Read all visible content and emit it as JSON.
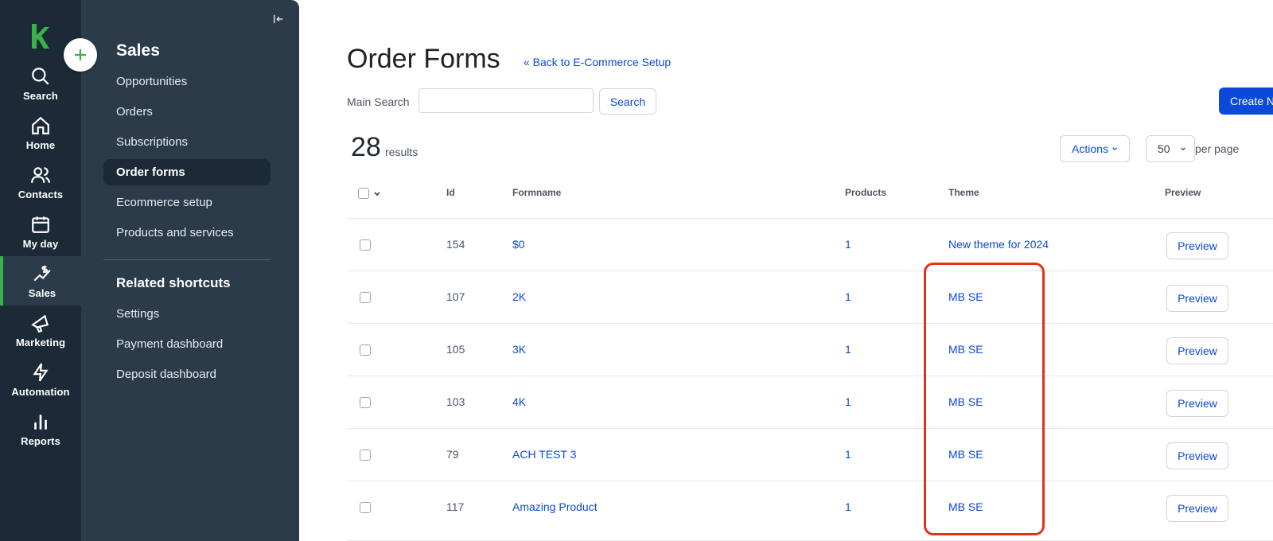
{
  "rail": {
    "items": [
      {
        "label": "Search",
        "icon": "search-icon"
      },
      {
        "label": "Home",
        "icon": "home-icon"
      },
      {
        "label": "Contacts",
        "icon": "contacts-icon"
      },
      {
        "label": "My day",
        "icon": "calendar-icon"
      },
      {
        "label": "Sales",
        "icon": "sales-icon",
        "active": true
      },
      {
        "label": "Marketing",
        "icon": "megaphone-icon"
      },
      {
        "label": "Automation",
        "icon": "lightning-icon"
      },
      {
        "label": "Reports",
        "icon": "bar-chart-icon"
      }
    ],
    "brand_color": "#37b34a"
  },
  "sidebar": {
    "title": "Sales",
    "items": [
      {
        "label": "Opportunities"
      },
      {
        "label": "Orders"
      },
      {
        "label": "Subscriptions"
      },
      {
        "label": "Order forms",
        "active": true
      },
      {
        "label": "Ecommerce setup"
      },
      {
        "label": "Products and services"
      }
    ],
    "shortcuts_title": "Related shortcuts",
    "shortcuts": [
      {
        "label": "Settings"
      },
      {
        "label": "Payment dashboard"
      },
      {
        "label": "Deposit dashboard"
      }
    ]
  },
  "header": {
    "title": "Order Forms",
    "back_link": "« Back to E-Commerce Setup",
    "search_label": "Main Search",
    "search_value": "",
    "search_button": "Search",
    "create_button": "Create N"
  },
  "summary": {
    "count": "28",
    "results_label": "results",
    "actions_label": "Actions",
    "per_page_value": "50",
    "per_page_label": "per page"
  },
  "table": {
    "columns": [
      "Id",
      "Formname",
      "Products",
      "Theme",
      "Preview"
    ],
    "rows": [
      {
        "id": "154",
        "formname": "$0",
        "products": "1",
        "theme": "New theme for 2024",
        "preview": "Preview"
      },
      {
        "id": "107",
        "formname": "2K",
        "products": "1",
        "theme": "MB SE",
        "preview": "Preview"
      },
      {
        "id": "105",
        "formname": "3K",
        "products": "1",
        "theme": "MB SE",
        "preview": "Preview"
      },
      {
        "id": "103",
        "formname": "4K",
        "products": "1",
        "theme": "MB SE",
        "preview": "Preview"
      },
      {
        "id": "79",
        "formname": "ACH TEST 3",
        "products": "1",
        "theme": "MB SE",
        "preview": "Preview"
      },
      {
        "id": "117",
        "formname": "Amazing Product",
        "products": "1",
        "theme": "MB SE",
        "preview": "Preview"
      }
    ]
  },
  "colors": {
    "link": "#0b49d9",
    "rail_bg": "#1b2a36",
    "sidebar_bg": "#2b3b49",
    "highlight": "#e6301c"
  }
}
